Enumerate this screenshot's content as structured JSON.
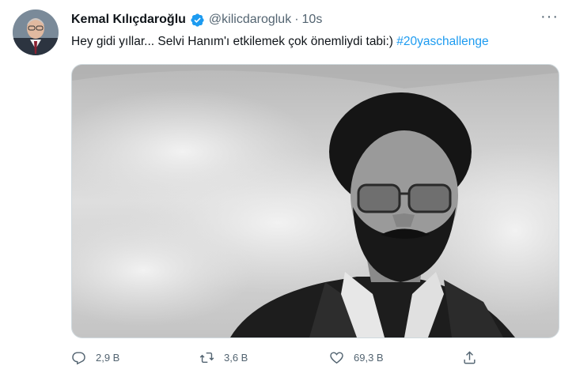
{
  "tweet": {
    "author": {
      "name": "Kemal Kılıçdaroğlu",
      "handle": "@kilicdarogluk",
      "separator": "·",
      "time": "10s"
    },
    "more_label": "···",
    "text": "Hey gidi yıllar... Selvi Hanım'ı etkilemek çok önemliydi tabi:) ",
    "hashtag": "#20yaschallenge",
    "actions": {
      "reply": {
        "icon": "reply-icon",
        "count": "2,9 B"
      },
      "retweet": {
        "icon": "retweet-icon",
        "count": "3,6 B"
      },
      "like": {
        "icon": "heart-icon",
        "count": "69,3 B"
      },
      "share": {
        "icon": "share-icon"
      }
    }
  },
  "colors": {
    "accent": "#1d9bf0",
    "secondary_text": "#536471",
    "primary_text": "#0f1419"
  }
}
